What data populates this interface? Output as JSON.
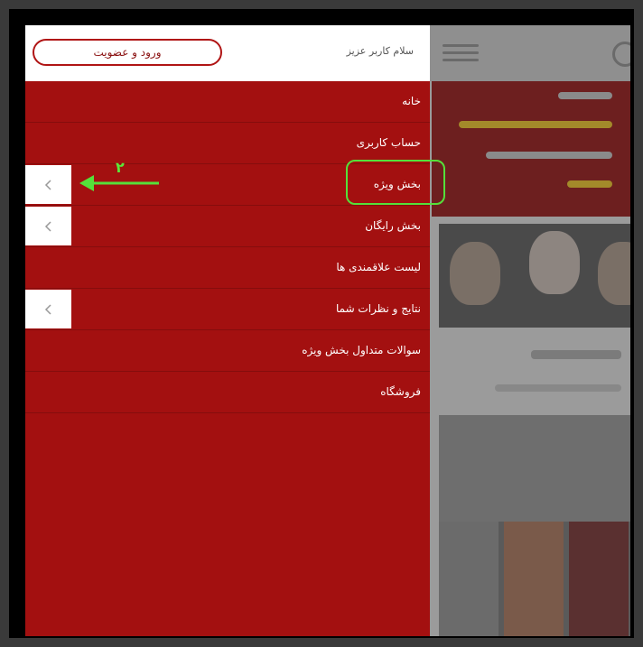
{
  "drawer": {
    "greeting": "سلام کاربر عزیز",
    "login_label": "ورود و عضویت",
    "items": [
      {
        "label": "خانه",
        "submenu": false
      },
      {
        "label": "حساب کاربری",
        "submenu": false
      },
      {
        "label": "بخش ویژه",
        "submenu": true
      },
      {
        "label": "بخش رایگان",
        "submenu": true
      },
      {
        "label": "لیست علاقمندی ها",
        "submenu": false
      },
      {
        "label": "نتایج و نظرات شما",
        "submenu": true
      },
      {
        "label": "سوالات متداول بخش ویژه",
        "submenu": false
      },
      {
        "label": "فروشگاه",
        "submenu": false
      }
    ]
  },
  "annotation": {
    "step_number": "۲",
    "color": "#55e03a"
  },
  "colors": {
    "drawer_bg": "#a31010",
    "header_bg": "#ffffff",
    "outer_frame": "#000000"
  },
  "icons": {
    "submenu_chevron": "chevron-left-icon",
    "annotation_arrow": "arrow-left-icon",
    "background_menu": "hamburger-icon",
    "background_search": "search-icon"
  }
}
